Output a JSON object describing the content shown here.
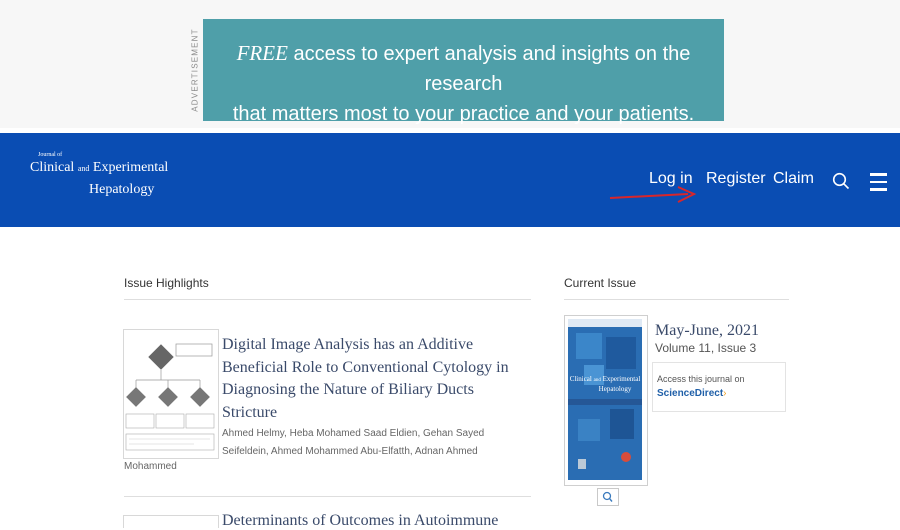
{
  "ad": {
    "label": "ADVERTISEMENT",
    "lead": "FREE",
    "line1": " access to expert analysis and insights on the research",
    "line2": "that matters most to your practice and your patients."
  },
  "header": {
    "logo_small": "Journal of",
    "logo_clinical": "Clinical",
    "logo_and": "and",
    "logo_experimental": "Experimental",
    "logo_hepatology": "Hepatology",
    "login": "Log in",
    "register": "Register",
    "claim": "Claim",
    "search_icon": "search-icon",
    "menu_icon": "hamburger-menu-icon",
    "brand_color": "#0a4db3"
  },
  "highlights": {
    "title": "Issue Highlights",
    "articles": [
      {
        "title": "Digital Image Analysis has an Additive Beneficial Role to Conventional Cytology in Diagnosing the Nature of Biliary Ducts Stricture",
        "authors_line1": "Ahmed Helmy, Heba Mohamed Saad Eldien, Gehan Sayed",
        "authors_line2": "Seifeldein, Ahmed Mohammed Abu-Elfatth, Adnan Ahmed",
        "authors_line3": "Mohammed"
      },
      {
        "title": "Determinants of Outcomes in Autoimmune"
      }
    ]
  },
  "current_issue": {
    "title": "Current Issue",
    "date": "May-June, 2021",
    "volume": "Volume 11, Issue 3",
    "access_text": "Access this journal on",
    "access_link": "ScienceDirect",
    "cover_journal_clinical": "Clinical",
    "cover_journal_and": "and",
    "cover_journal_experimental": "Experimental",
    "cover_journal_hepatology": "Hepatology",
    "zoom_icon": "magnifier-icon"
  }
}
